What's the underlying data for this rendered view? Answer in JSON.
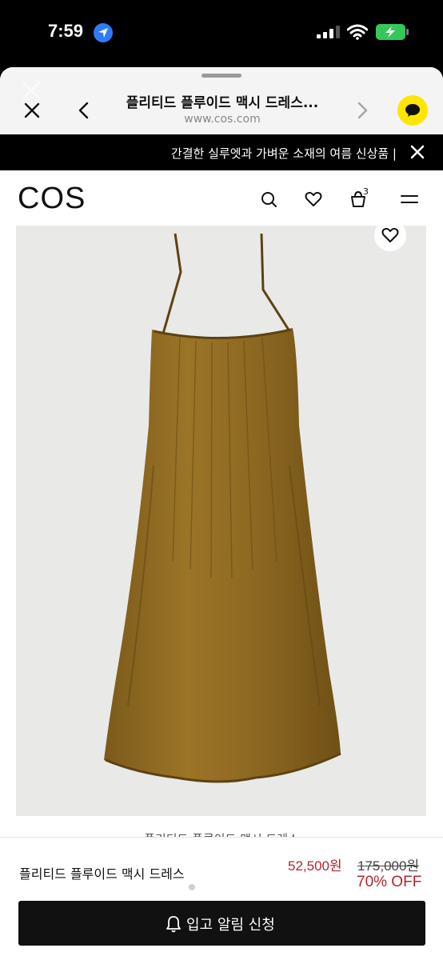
{
  "status": {
    "time": "7:59",
    "location_icon": "location-arrow-icon",
    "signal_icon": "cellular-signal-icon",
    "wifi_icon": "wifi-icon",
    "battery_icon": "battery-charging-icon",
    "battery_color": "#36c75a"
  },
  "browser": {
    "title": "플리티드 플루이드 맥시 드레스...",
    "url": "www.cos.com",
    "close_icon": "close-icon",
    "back_icon": "chevron-left-icon",
    "forward_icon": "chevron-right-icon",
    "chat_icon": "kakaotalk-icon",
    "chat_color": "#ffe600"
  },
  "promo": {
    "text": "간결한 실루엣과 가벼운 소재의 여름 신상품 |",
    "close_icon": "close-icon"
  },
  "header": {
    "logo": "COS",
    "search_icon": "search-icon",
    "wishlist_icon": "heart-icon",
    "bag_icon": "shopping-bag-icon",
    "bag_count": "3",
    "menu_icon": "hamburger-menu-icon"
  },
  "product": {
    "image": "olive-brown-pleated-maxi-dress",
    "favorite_icon": "heart-icon",
    "name": "플리티드 플루이드 맥시 드레스",
    "sale_price": "52,500원",
    "original_price": "175,000원",
    "discount": "70% OFF",
    "sale_color": "#b8232e"
  },
  "cta": {
    "label": "입고 알림 신청",
    "icon": "bell-icon"
  }
}
